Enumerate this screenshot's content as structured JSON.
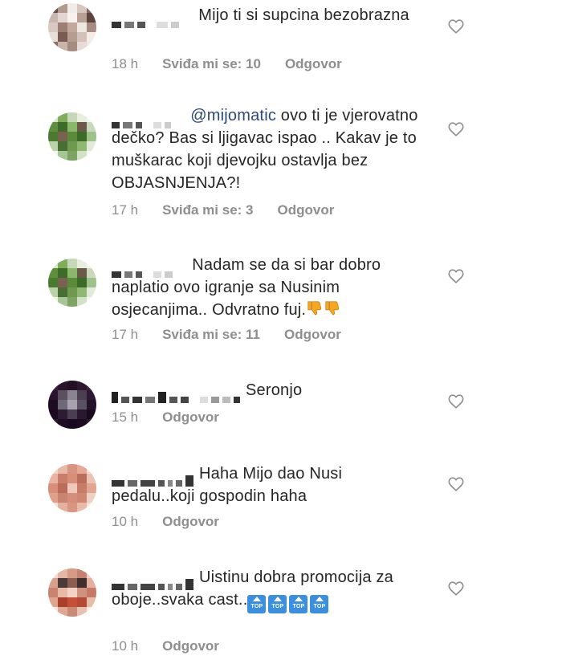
{
  "comments": [
    {
      "text": "Mijo ti si supcina bezobrazna",
      "time": "18 h",
      "likes": "Sviđa mi se: 10",
      "reply": "Odgovor",
      "avatar": [
        "#6a4e45",
        "#b09a8e",
        "#f2ece8",
        "#d6c7c0",
        "#8a6a60",
        "#c8b7b0",
        "#e3d6d0",
        "#f7f2ee",
        "#b8a096",
        "#5c433c",
        "#d8c9c3",
        "#9c7f74",
        "#c3a89c",
        "#efe7e2",
        "#a88c82",
        "#e9dfd9",
        "#7a5b51",
        "#b79c91",
        "#d4c1b9",
        "#f3ece7",
        "#8c6e63",
        "#c9b3aa",
        "#a58b80",
        "#e6dbd5",
        "#f0e9e4"
      ]
    },
    {
      "mention": "@mijomatic",
      "text": " ovo ti je vjerovatno dečko? Bas si ljigavac ispao .. Kakav je to muškarac koji djevojku ostavlja bez OBJASNJENJA?!",
      "time": "17 h",
      "likes": "Sviđa mi se: 3",
      "reply": "Odgovor",
      "avatar": [
        "#d9e3d0",
        "#7fae5a",
        "#c6d8b8",
        "#e8efe1",
        "#f2f5ef",
        "#5e8f3c",
        "#3f6b2a",
        "#8ab86a",
        "#6b5a4a",
        "#c9d9bb",
        "#4a7a30",
        "#7a6250",
        "#5a8a3a",
        "#3c6a28",
        "#9fc28a",
        "#bcd3a9",
        "#486e34",
        "#6f9950",
        "#8fb873",
        "#e2ebd9",
        "#f0f4ec",
        "#a7c695",
        "#7ea463",
        "#d3e2c6",
        "#f6f8f3"
      ]
    },
    {
      "text": "Nadam se da si bar dobro naplatio ovo igranje sa Nusinim osjecanjima.. Odvratno fuj.",
      "time": "17 h",
      "likes": "Sviđa mi se: 11",
      "reply": "Odgovor",
      "avatar": [
        "#d9e3d0",
        "#7fae5a",
        "#c6d8b8",
        "#e8efe1",
        "#f2f5ef",
        "#5e8f3c",
        "#3f6b2a",
        "#8ab86a",
        "#6b5a4a",
        "#c9d9bb",
        "#4a7a30",
        "#7a6250",
        "#5a8a3a",
        "#3c6a28",
        "#9fc28a",
        "#bcd3a9",
        "#486e34",
        "#6f9950",
        "#8fb873",
        "#e2ebd9",
        "#f0f4ec",
        "#a7c695",
        "#7ea463",
        "#d3e2c6",
        "#f6f8f3"
      ]
    },
    {
      "text": "Seronjo",
      "time": "15 h",
      "reply": "Odgovor",
      "avatar": [
        "#3a1f3a",
        "#2a142c",
        "#221024",
        "#2e182f",
        "#3b2240",
        "#2a1530",
        "#5a5060",
        "#8a8490",
        "#4a4052",
        "#2c1832",
        "#1e0c22",
        "#6f6878",
        "#a7a2ad",
        "#5a5164",
        "#24112a",
        "#1c0a20",
        "#2d1a33",
        "#4a3f50",
        "#2a1730",
        "#1a0a1e",
        "#2a1a2e",
        "#1f0d24",
        "#180820",
        "#1d0b22",
        "#2a1a30"
      ]
    },
    {
      "text": "Haha Mijo dao Nusi pedalu..koji gospodin haha",
      "time": "10 h",
      "reply": "Odgovor",
      "avatar": [
        "#f2d6cc",
        "#e8b8a8",
        "#d99480",
        "#e7a994",
        "#f4ddd4",
        "#e9b4a2",
        "#c87e6a",
        "#d78f79",
        "#b96f5c",
        "#ecc2b3",
        "#d88e78",
        "#b96c58",
        "#f0c9bb",
        "#c57c68",
        "#e2a592",
        "#e1a08c",
        "#c98470",
        "#d48f7b",
        "#cf8672",
        "#efd0c4",
        "#f5e1d9",
        "#e6b09e",
        "#d8957f",
        "#eab9a8",
        "#f6e4dc"
      ]
    },
    {
      "text": "Uistinu dobra promocija za oboje..svaka cast..",
      "time": "10 h",
      "reply": "Odgovor",
      "avatar": [
        "#f3ddd3",
        "#e6b6a4",
        "#d79a86",
        "#c58270",
        "#f0d2c6",
        "#d9a08b",
        "#4a3a3a",
        "#8a5e50",
        "#3e2e2e",
        "#e4b09d",
        "#c88470",
        "#e8b9a6",
        "#f2d3c5",
        "#d09280",
        "#c47a66",
        "#e0a590",
        "#a8402c",
        "#c4503a",
        "#b44a36",
        "#e9bcaa",
        "#f6e6de",
        "#e0a893",
        "#c98a76",
        "#e8c0b0",
        "#f8ece6"
      ]
    }
  ],
  "emoji": {
    "thumbs_down": "thumbs-down",
    "top": "TOP"
  }
}
